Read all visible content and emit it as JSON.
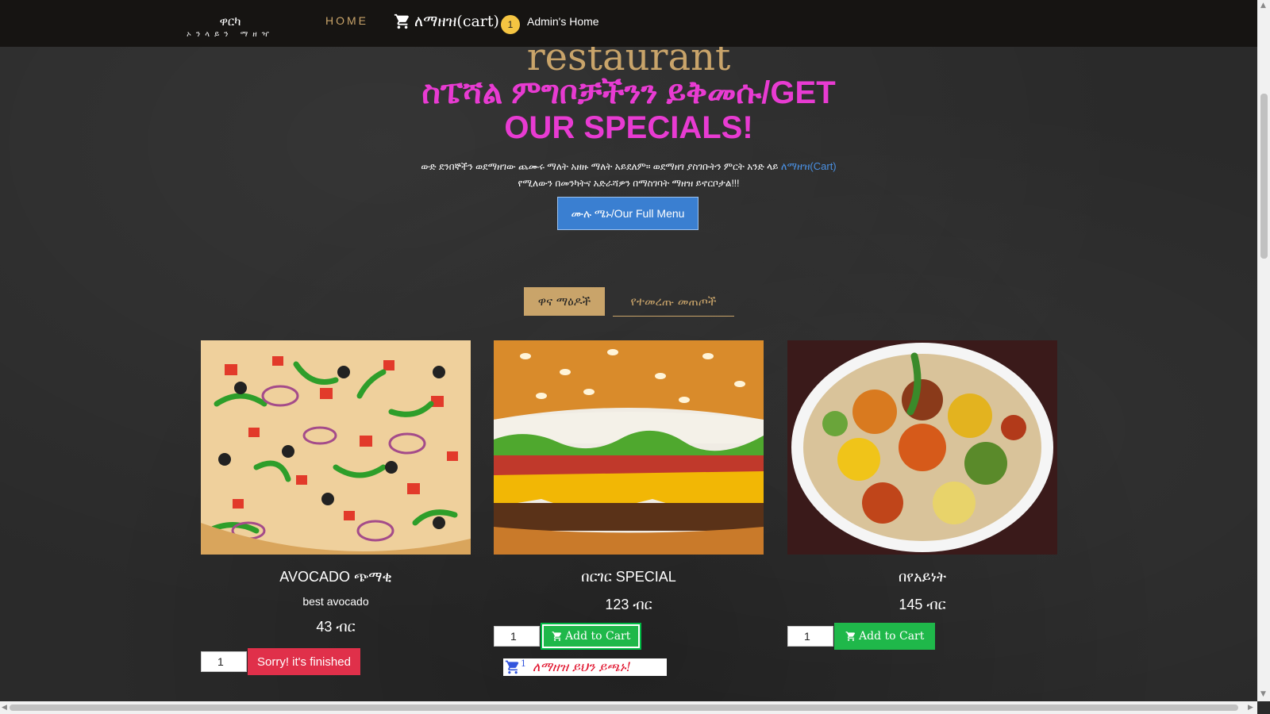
{
  "nav": {
    "brand_main": "ዋርካ",
    "brand_sub": "ኦንላይን ማዘዣ",
    "home": "HOME",
    "cart_label": "ለማዘዝ(cart)",
    "cart_count": "1",
    "admin": "Admin's Home"
  },
  "hero": {
    "word": "restaurant",
    "title": "ስፔሻል ምግቦቻችንን ይቅመሱ/GET OUR SPECIALS!",
    "desc_before": "ውድ ደንበኞችን ወደማዘገው ጨሙሩ ማለት አዘዙ ማለት አይደለም። ወደማዘገ ያስገቡትን ምርት አንድ ላይ",
    "desc_link": "ለማዘዝ(Cart)",
    "desc_after": "የሚለውን በመንካትና አድራሻዎን በማስገባት ማዘዝ ይኖርቦታል!!!",
    "menu_button": "ሙሉ ሜኑ/Our Full Menu"
  },
  "tabs": {
    "active": "ዋና ማዕዶች",
    "inactive": "የተመረጡ መጠጦች"
  },
  "products": [
    {
      "name": "AVOCADO ጭማቂ",
      "desc": "best avocado",
      "price": "43 ብር",
      "qty": "1",
      "button": "Sorry! it's finished"
    },
    {
      "name": "በርገር SPECIAL",
      "price": "123 ብር",
      "qty": "1",
      "button": "Add to Cart"
    },
    {
      "name": "በየአይነት",
      "price": "145 ብር",
      "qty": "1",
      "button": "Add to Cart"
    }
  ],
  "added_message": {
    "count": "1",
    "text": "ለማዘዝ ይህን ይጫኑ!"
  },
  "colors": {
    "accent_gold": "#c9a46a",
    "title_pink": "#e83bd2",
    "button_blue": "#3a7fd1",
    "button_green": "#1fb84a",
    "button_red": "#e0304a"
  }
}
